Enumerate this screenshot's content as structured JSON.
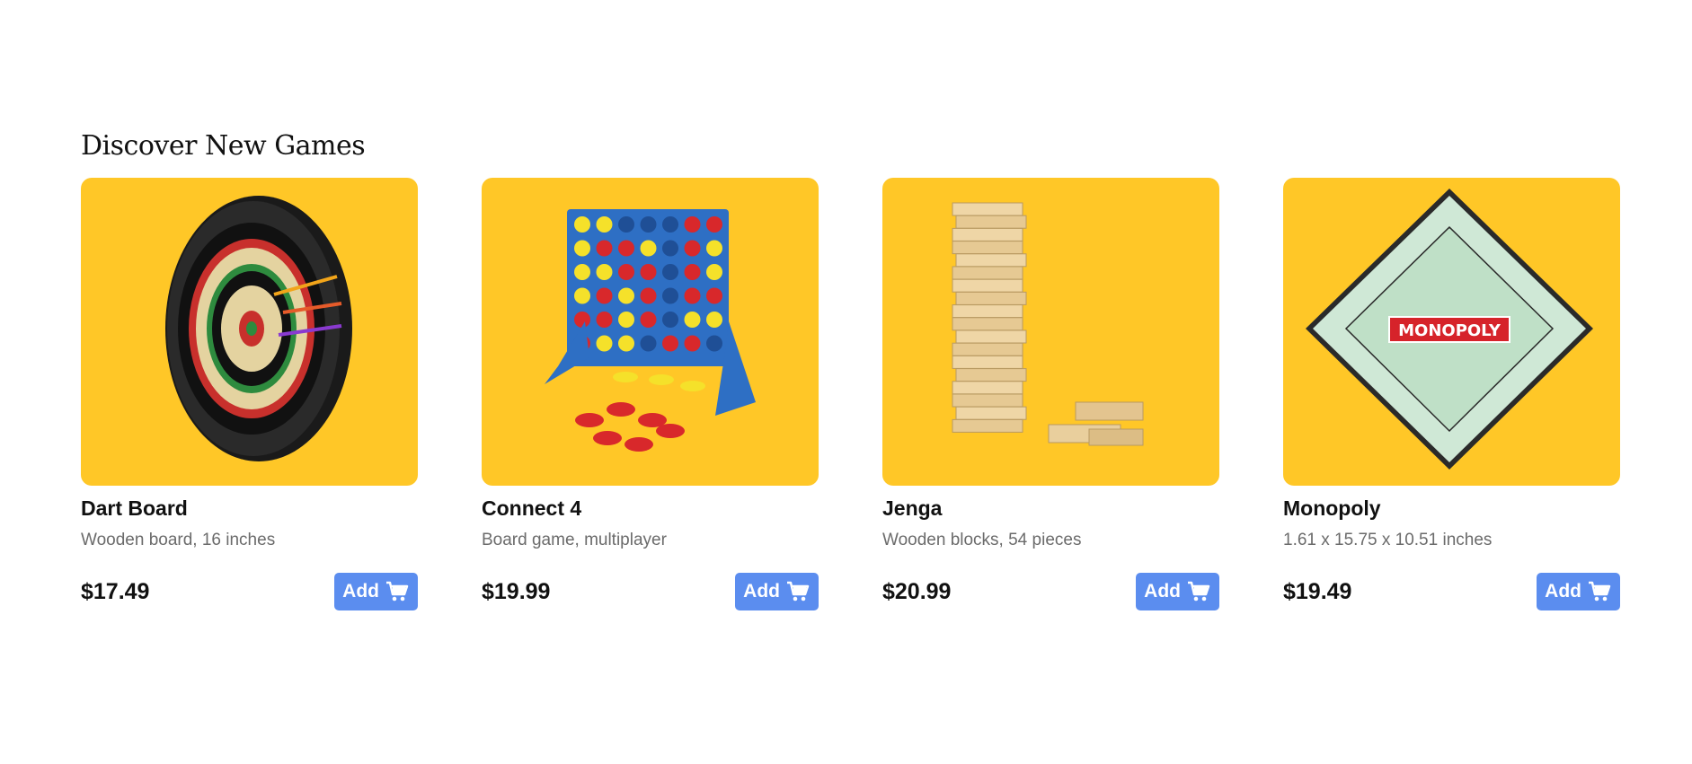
{
  "section": {
    "title": "Discover New Games"
  },
  "products": [
    {
      "name": "Dart Board",
      "description": "Wooden board, 16 inches",
      "price": "$17.49",
      "button_label": "Add",
      "image_icon": "dart-board-icon"
    },
    {
      "name": "Connect 4",
      "description": "Board game, multiplayer",
      "price": "$19.99",
      "button_label": "Add",
      "image_icon": "connect-four-icon"
    },
    {
      "name": "Jenga",
      "description": "Wooden blocks, 54 pieces",
      "price": "$20.99",
      "button_label": "Add",
      "image_icon": "jenga-tower-icon"
    },
    {
      "name": "Monopoly",
      "description": "1.61 x 15.75 x 10.51 inches",
      "price": "$19.49",
      "button_label": "Add",
      "image_icon": "monopoly-board-icon",
      "image_text": "MONOPOLY"
    }
  ],
  "colors": {
    "card_background": "#FFC727",
    "button_background": "#5B8DEF",
    "button_text": "#FFFFFF",
    "description_text": "#6B6B6B"
  },
  "icons": {
    "cart": "shopping-cart-icon"
  }
}
